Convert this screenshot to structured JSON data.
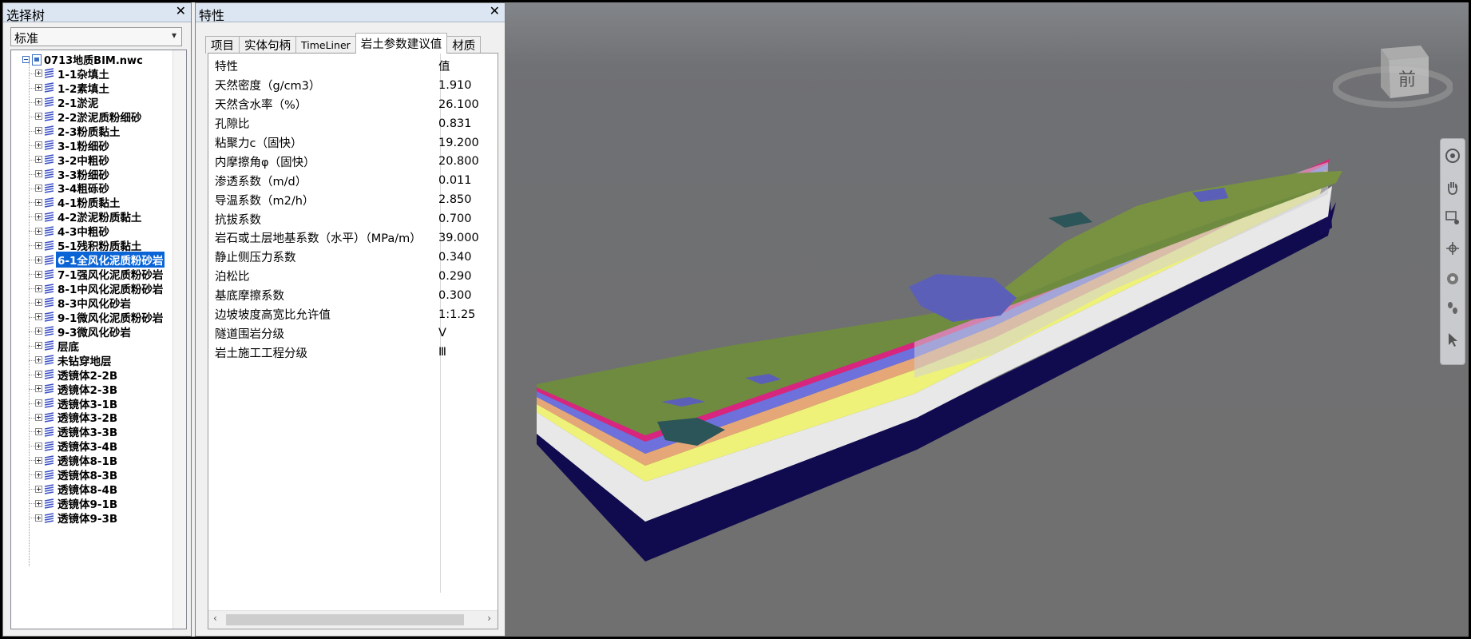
{
  "tree_panel": {
    "title": "选择树",
    "close": "✕",
    "dropdown_value": "标准",
    "root": "0713地质BIM.nwc",
    "items": [
      {
        "label": "1-1杂填土"
      },
      {
        "label": "1-2素填土"
      },
      {
        "label": "2-1淤泥"
      },
      {
        "label": "2-2淤泥质粉细砂"
      },
      {
        "label": "2-3粉质黏土"
      },
      {
        "label": "3-1粉细砂"
      },
      {
        "label": "3-2中粗砂"
      },
      {
        "label": "3-3粉细砂"
      },
      {
        "label": "3-4粗砾砂"
      },
      {
        "label": "4-1粉质黏土"
      },
      {
        "label": "4-2淤泥粉质黏土"
      },
      {
        "label": "4-3中粗砂"
      },
      {
        "label": "5-1残积粉质黏土"
      },
      {
        "label": "6-1全风化泥质粉砂岩",
        "selected": true
      },
      {
        "label": "7-1强风化泥质粉砂岩"
      },
      {
        "label": "8-1中风化泥质粉砂岩"
      },
      {
        "label": "8-3中风化砂岩"
      },
      {
        "label": "9-1微风化泥质粉砂岩"
      },
      {
        "label": "9-3微风化砂岩"
      },
      {
        "label": "层底"
      },
      {
        "label": "未钻穿地层"
      },
      {
        "label": "透镜体2-2B"
      },
      {
        "label": "透镜体2-3B"
      },
      {
        "label": "透镜体3-1B"
      },
      {
        "label": "透镜体3-2B"
      },
      {
        "label": "透镜体3-3B"
      },
      {
        "label": "透镜体3-4B"
      },
      {
        "label": "透镜体8-1B"
      },
      {
        "label": "透镜体8-3B"
      },
      {
        "label": "透镜体8-4B"
      },
      {
        "label": "透镜体9-1B"
      },
      {
        "label": "透镜体9-3B"
      }
    ]
  },
  "prop_panel": {
    "title": "特性",
    "close": "✕",
    "tabs": [
      {
        "label": "项目"
      },
      {
        "label": "实体句柄"
      },
      {
        "label": "TimeLiner"
      },
      {
        "label": "岩土参数建议值",
        "active": true
      },
      {
        "label": "材质"
      }
    ],
    "header": {
      "key": "特性",
      "value": "值"
    },
    "rows": [
      {
        "key": "天然密度（g/cm3）",
        "value": "1.910"
      },
      {
        "key": "天然含水率（%）",
        "value": "26.100"
      },
      {
        "key": "孔隙比",
        "value": "0.831"
      },
      {
        "key": "粘聚力c（固快）",
        "value": "19.200"
      },
      {
        "key": "内摩擦角φ（固快）",
        "value": "20.800"
      },
      {
        "key": "渗透系数（m/d）",
        "value": "0.011"
      },
      {
        "key": "导温系数（m2/h）",
        "value": "2.850"
      },
      {
        "key": "抗拔系数",
        "value": "0.700"
      },
      {
        "key": "岩石或土层地基系数（水平）（MPa/m）",
        "value": "39.000"
      },
      {
        "key": "静止侧压力系数",
        "value": "0.340"
      },
      {
        "key": "泊松比",
        "value": "0.290"
      },
      {
        "key": "基底摩擦系数",
        "value": "0.300"
      },
      {
        "key": "边坡坡度高宽比允许值",
        "value": "1:1.25"
      },
      {
        "key": "隧道围岩分级",
        "value": "V"
      },
      {
        "key": "岩土施工工程分级",
        "value": "Ⅲ"
      }
    ],
    "scroll_left": "‹",
    "scroll_right": "›"
  },
  "viewport": {
    "viewcube_face": "前",
    "colors": {
      "surface": "#6e8a3c",
      "bedrock": "#100a4f",
      "white_layer": "#e6e6e6",
      "yellow_layer": "#f0f47a",
      "orange_layer": "#e8a070",
      "blue_layer": "#6a6ad8",
      "magenta_layer": "#e0207a"
    }
  }
}
